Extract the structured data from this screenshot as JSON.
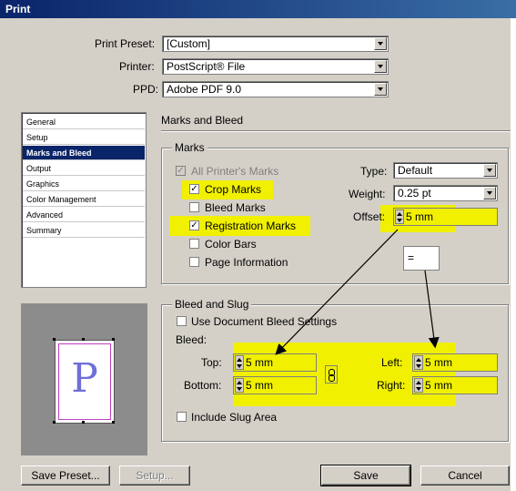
{
  "window": {
    "title": "Print"
  },
  "header": {
    "preset_label": "Print Preset:",
    "preset_value": "[Custom]",
    "printer_label": "Printer:",
    "printer_value": "PostScript® File",
    "ppd_label": "PPD:",
    "ppd_value": "Adobe PDF 9.0"
  },
  "sidebar": {
    "items": [
      {
        "label": "General"
      },
      {
        "label": "Setup"
      },
      {
        "label": "Marks and Bleed",
        "selected": true
      },
      {
        "label": "Output"
      },
      {
        "label": "Graphics"
      },
      {
        "label": "Color Management"
      },
      {
        "label": "Advanced"
      },
      {
        "label": "Summary"
      }
    ]
  },
  "preview": {
    "letter": "P"
  },
  "panel": {
    "title": "Marks and Bleed"
  },
  "marks": {
    "group_title": "Marks",
    "all_printers_marks": {
      "label": "All Printer's Marks",
      "checked": true,
      "disabled": true
    },
    "crop_marks": {
      "label": "Crop Marks",
      "checked": true
    },
    "bleed_marks": {
      "label": "Bleed Marks",
      "checked": false
    },
    "registration_marks": {
      "label": "Registration Marks",
      "checked": true
    },
    "color_bars": {
      "label": "Color Bars",
      "checked": false
    },
    "page_information": {
      "label": "Page Information",
      "checked": false
    },
    "type_label": "Type:",
    "type_value": "Default",
    "weight_label": "Weight:",
    "weight_value": "0.25 pt",
    "offset_label": "Offset:",
    "offset_value": "5 mm"
  },
  "bleed": {
    "group_title": "Bleed and Slug",
    "use_document": {
      "label": "Use Document Bleed Settings",
      "checked": false
    },
    "bleed_label": "Bleed:",
    "top_label": "Top:",
    "top_value": "5 mm",
    "bottom_label": "Bottom:",
    "bottom_value": "5 mm",
    "left_label": "Left:",
    "left_value": "5 mm",
    "right_label": "Right:",
    "right_value": "5 mm",
    "include_slug": {
      "label": "Include Slug Area",
      "checked": false
    }
  },
  "annotation": {
    "equals": "="
  },
  "buttons": {
    "save_preset": "Save Preset...",
    "setup": "Setup...",
    "save": "Save",
    "cancel": "Cancel"
  },
  "colors": {
    "highlight": "#f0f000",
    "titlebar": "#0a246a",
    "selection": "#0a246a"
  }
}
